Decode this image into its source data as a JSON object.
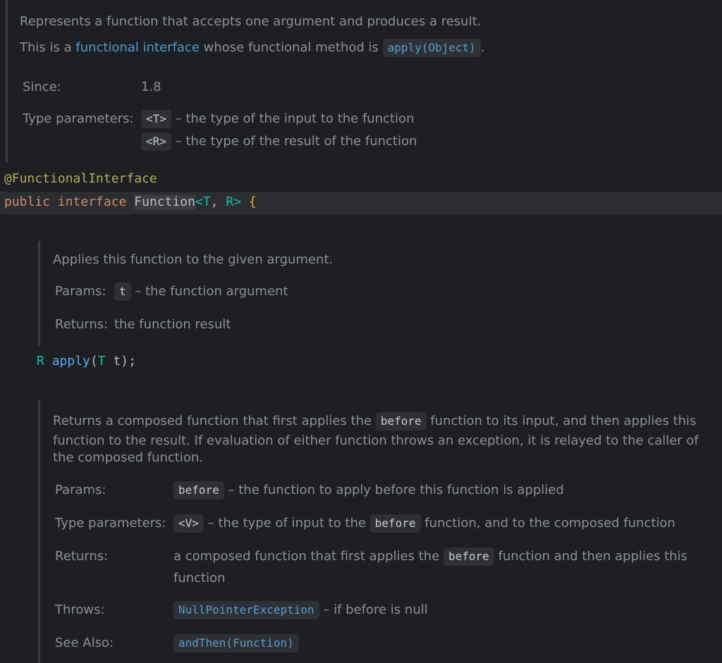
{
  "colors": {
    "background": "#1e1f22",
    "doc_text": "#8c9097",
    "keyword": "#cf8e6d",
    "annotation": "#b3ae60",
    "type_param": "#16baac",
    "method": "#56a8f5",
    "link": "#4f9bd6"
  },
  "interface_doc": {
    "summary": "Represents a function that accepts one argument and produces a result.",
    "functional_prefix": "This is a ",
    "functional_link": "functional interface",
    "functional_mid": " whose functional method is ",
    "functional_method": "apply(Object)",
    "functional_suffix": ".",
    "since_label": "Since:",
    "since_value": "1.8",
    "type_params_label": "Type parameters:",
    "tp1_name": "<T>",
    "tp1_desc": " – the type of the input to the function",
    "tp2_name": "<R>",
    "tp2_desc": " – the type of the result of the function"
  },
  "code": {
    "annotation": "@FunctionalInterface",
    "kw_public": "public",
    "kw_interface": "interface",
    "class_name": "Function",
    "generic_open": "<",
    "generic_T": "T",
    "generic_sep": ", ",
    "generic_R": "R",
    "generic_close": ">",
    "brace": "{",
    "apply_return": "R",
    "apply_name": "apply",
    "apply_open": "(",
    "apply_param_type": "T",
    "apply_param_name": " t",
    "apply_close": ");"
  },
  "apply_doc": {
    "summary": "Applies this function to the given argument.",
    "params_label": "Params:",
    "param_name": "t",
    "param_desc": " – the function argument",
    "returns_label": "Returns:",
    "returns_desc": "the function result"
  },
  "compose_doc": {
    "summary_a": "Returns a composed function that first applies the ",
    "summary_code": "before",
    "summary_b": " function to its input, and then applies this",
    "summary_line2": "function to the result. If evaluation of either function throws an exception, it is relayed to the caller of",
    "summary_line3": "the composed function.",
    "params_label": "Params:",
    "param_name": "before",
    "param_desc": " – the function to apply before this function is applied",
    "type_params_label": "Type parameters:",
    "tp_name": "<V>",
    "tp_desc_a": " – the type of input to the ",
    "tp_code": "before",
    "tp_desc_b": " function, and to the composed function",
    "returns_label": "Returns:",
    "returns_a": "a composed function that first applies the ",
    "returns_code": "before",
    "returns_b": " function and then applies this",
    "returns_line2": "function",
    "throws_label": "Throws:",
    "throws_name": "NullPointerException",
    "throws_desc": " – if before is null",
    "see_also_label": "See Also:",
    "see_also_link": "andThen(Function)"
  }
}
